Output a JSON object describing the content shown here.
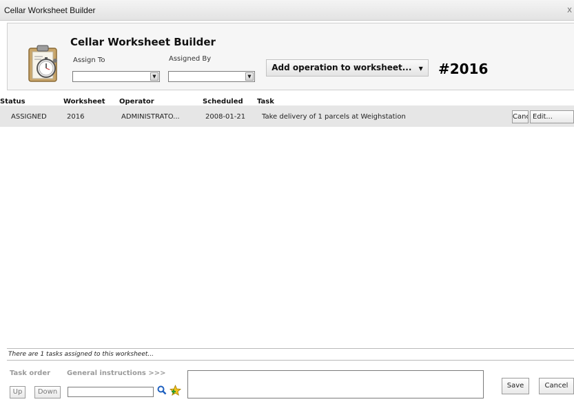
{
  "window": {
    "title": "Cellar Worksheet Builder",
    "close_glyph": "x"
  },
  "header": {
    "title": "Cellar Worksheet Builder",
    "assign_to_label": "Assign To",
    "assigned_by_label": "Assigned By",
    "assign_to_value": "",
    "assigned_by_value": "",
    "add_operation_label": "Add operation to worksheet...",
    "worksheet_number": "#2016",
    "icon": "clipboard-stopwatch-icon"
  },
  "table": {
    "columns": [
      "Status",
      "Worksheet",
      "Operator",
      "Scheduled",
      "Task"
    ],
    "rows": [
      {
        "status": "ASSIGNED",
        "worksheet": "2016",
        "operator": "ADMINISTRATO...",
        "scheduled": "2008-01-21",
        "task": "Take delivery of 1 parcels at Weighstation",
        "cancel_label": "Cancel",
        "edit_label": "Edit..."
      }
    ]
  },
  "status_text": "There are 1 tasks assigned to this worksheet...",
  "footer": {
    "task_order_label": "Task order",
    "general_instructions_label": "General instructions >>>",
    "up_label": "Up",
    "down_label": "Down",
    "search_value": "",
    "instructions_text": "",
    "save_label": "Save",
    "cancel_label": "Cancel"
  },
  "colors": {
    "row_highlight": "#e6e6e6",
    "header_bg": "#f6f6f6",
    "muted_label": "#9a9a9a"
  }
}
